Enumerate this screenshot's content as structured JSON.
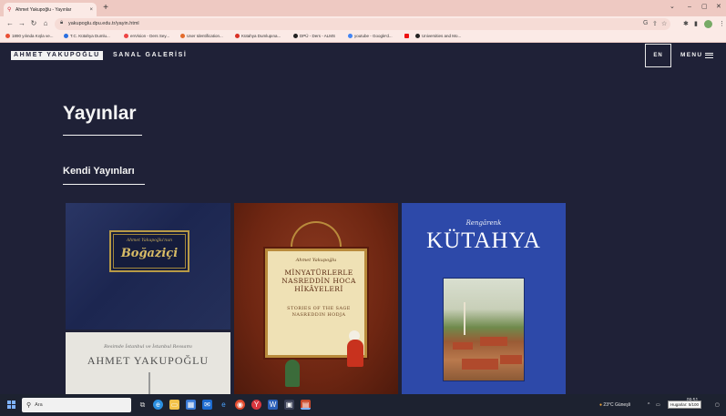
{
  "browser": {
    "tab_title": "Ahmet Yakupoğlu - Yayınlar",
    "tab_close": "×",
    "new_tab": "+",
    "url": "yakupoglu.dpu.edu.tr/yayin.html",
    "window_controls": [
      "⌄",
      "–",
      "▢",
      "✕"
    ],
    "bookmarks": [
      {
        "label": "1890 yılında Kışla ve...",
        "color": "#e94f35"
      },
      {
        "label": "T.C. Kütahya Dumlu...",
        "color": "#2a6fe0"
      },
      {
        "label": "enVision - Ders Sey...",
        "color": "#e44"
      },
      {
        "label": "User Identification...",
        "color": "#e36b2c"
      },
      {
        "label": "Kütahya Dumlupına...",
        "color": "#d93025"
      },
      {
        "label": "DPÜ - Ders - ALMS",
        "color": "#222"
      },
      {
        "label": "youtube - Google'd...",
        "color": "#4285f4"
      },
      {
        "label": "",
        "color": "#e11"
      },
      {
        "label": "Universities and Mo...",
        "color": "#222"
      }
    ]
  },
  "site": {
    "brand_main": "AHMET YAKUPOĞLU",
    "brand_rest": "SANAL GALERİSİ",
    "lang_label": "EN",
    "menu_label": "MENU",
    "page_title": "Yayınlar",
    "section_title": "Kendi Yayınları",
    "covers": {
      "bogazici": {
        "author": "Ahmet Yakupoğlu'nun",
        "title": "Boğaziçi"
      },
      "istanbul": {
        "subtitle": "Resimde İstanbul ve İstanbul Ressamı",
        "name": "AHMET YAKUPOĞLU"
      },
      "minyatur": {
        "author": "Ahmet Yakupoğlu",
        "title": "MİNYATÜRLERLE NASREDDİN HOCA HİKÂYELERİ",
        "subtitle": "STORIES OF THE SAGE NASREDDIN HODJA"
      },
      "kutahya": {
        "pre": "Rengârenk",
        "title": "KÜTAHYA"
      }
    }
  },
  "taskbar": {
    "search_placeholder": "Ara",
    "weather": "23°C Güneşli",
    "time": "09:51",
    "date": "",
    "tooltip": "Hugarlar: 5/100"
  }
}
